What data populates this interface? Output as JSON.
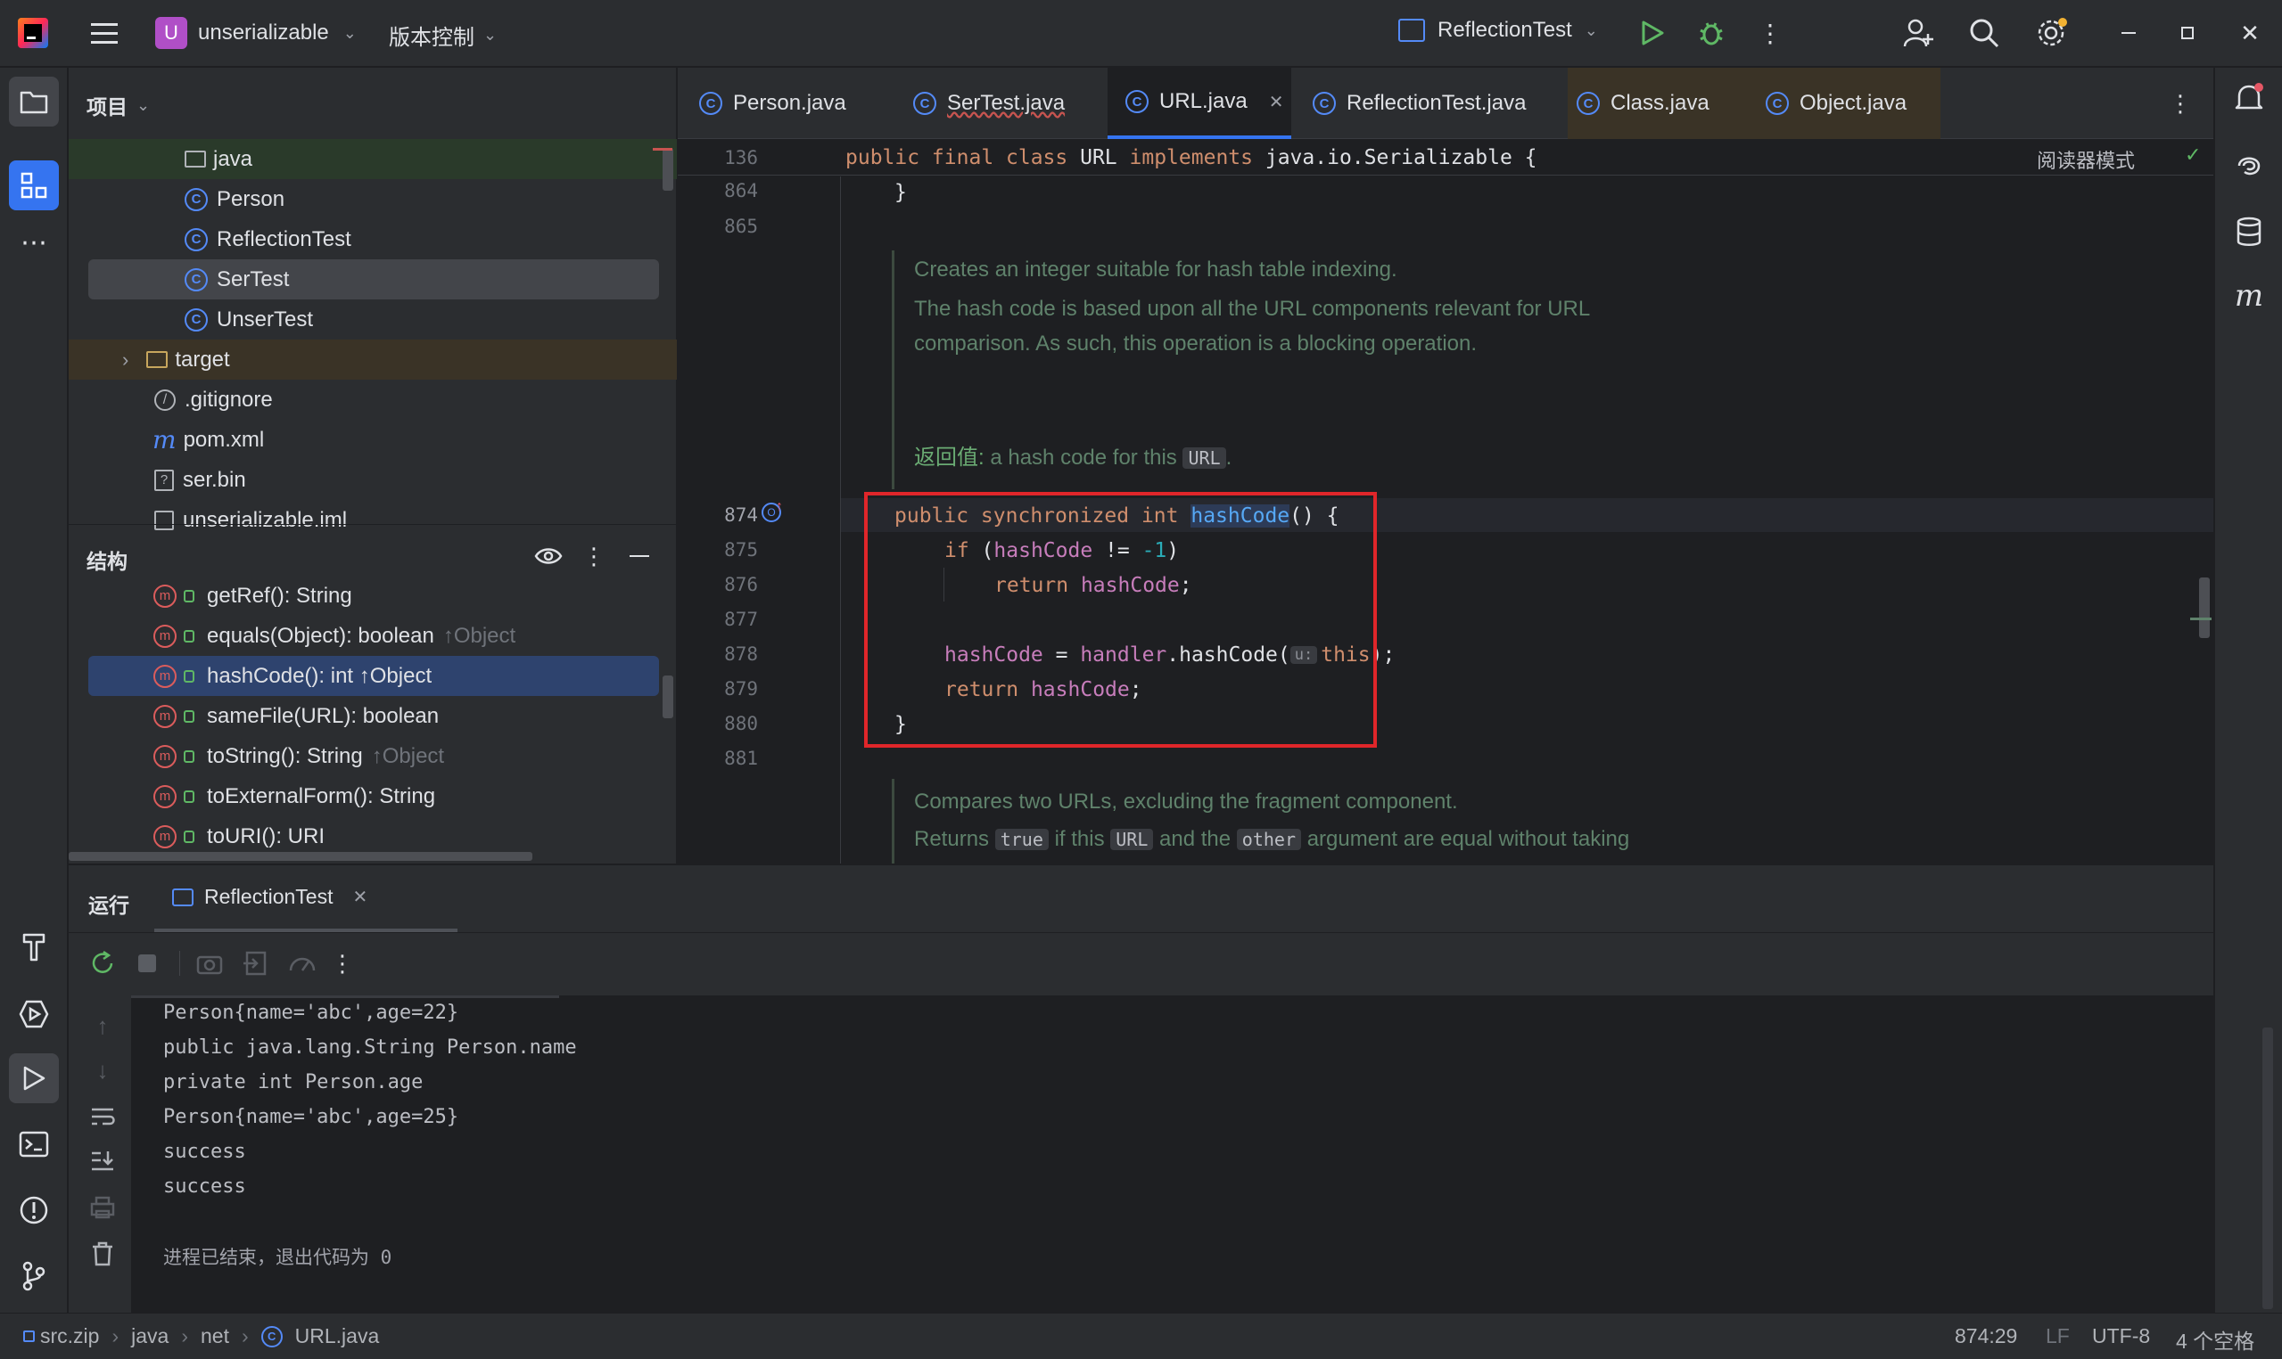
{
  "titlebar": {
    "project_badge": "U",
    "project_name": "unserializable",
    "vcs_label": "版本控制",
    "run_config": "ReflectionTest"
  },
  "project_panel": {
    "title": "项目",
    "items": [
      "java",
      "Person",
      "ReflectionTest",
      "SerTest",
      "UnserTest",
      "target",
      ".gitignore",
      "pom.xml",
      "ser.bin",
      "unserializable.iml"
    ]
  },
  "structure_panel": {
    "title": "结构",
    "items": [
      {
        "name": "getRef(): String",
        "suffix": ""
      },
      {
        "name": "equals(Object): boolean",
        "suffix": "↑Object"
      },
      {
        "name": "hashCode(): int ↑Object",
        "suffix": ""
      },
      {
        "name": "sameFile(URL): boolean",
        "suffix": ""
      },
      {
        "name": "toString(): String",
        "suffix": "↑Object"
      },
      {
        "name": "toExternalForm(): String",
        "suffix": ""
      },
      {
        "name": "toURI(): URI",
        "suffix": ""
      }
    ]
  },
  "editor": {
    "tabs": [
      "Person.java",
      "SerTest.java",
      "URL.java",
      "ReflectionTest.java",
      "Class.java",
      "Object.java"
    ],
    "active_tab": "URL.java",
    "reader_mode": "阅读器模式",
    "sticky_line_num": "136",
    "sticky_code": {
      "kw": "public final class",
      "name": "URL",
      "kw2": "implements",
      "rest": "java.io.Serializable {"
    },
    "line_numbers": [
      "864",
      "865",
      "874",
      "875",
      "876",
      "877",
      "878",
      "879",
      "880",
      "881"
    ],
    "doc1": {
      "line1": "Creates an integer suitable for hash table indexing.",
      "line2": "The hash code is based upon all the URL components relevant for URL",
      "line3": "comparison. As such, this operation is a blocking operation.",
      "returns_label": "返回值:",
      "returns_text": "a hash code for this",
      "returns_code": "URL",
      "returns_end": "."
    },
    "code": {
      "l864": "}",
      "l874_kw": "public synchronized int",
      "l874_fn": "hashCode",
      "l874_end": "() {",
      "l875_kw": "if",
      "l875_a": " (",
      "l875_fld": "hashCode",
      "l875_op": " != ",
      "l875_num": "-1",
      "l875_end": ")",
      "l876_kw": "return",
      "l876_fld": "hashCode",
      "l876_end": ";",
      "l878_fld": "hashCode",
      "l878_eq": " = ",
      "l878_h": "handler",
      "l878_call": ".hashCode(",
      "l878_hint": "u:",
      "l878_this": "this",
      "l878_end": ");",
      "l879_kw": "return",
      "l879_fld": "hashCode",
      "l879_end": ";",
      "l880": "}"
    },
    "doc2": {
      "line1": "Compares two URLs, excluding the fragment component.",
      "line2_a": "Returns",
      "line2_c1": "true",
      "line2_b": "if this",
      "line2_c2": "URL",
      "line2_c": "and the",
      "line2_c3": "other",
      "line2_d": "argument are equal without taking"
    }
  },
  "run_panel": {
    "title": "运行",
    "tab": "ReflectionTest",
    "output": [
      "Person{name='abc',age=22}",
      "public java.lang.String Person.name",
      "private int Person.age",
      "Person{name='abc',age=25}",
      "success",
      "success",
      "",
      "进程已结束，退出代码为 0"
    ]
  },
  "statusbar": {
    "breadcrumb": [
      "src.zip",
      "java",
      "net",
      "URL.java"
    ],
    "position": "874:29",
    "line_sep": "LF",
    "encoding": "UTF-8",
    "indent": "4 个空格"
  },
  "colors": {
    "accent": "#3574f0",
    "highlight_box": "#e0262a",
    "keyword": "#cf8e6d",
    "field": "#c77dbb",
    "doc": "#5f826b"
  }
}
